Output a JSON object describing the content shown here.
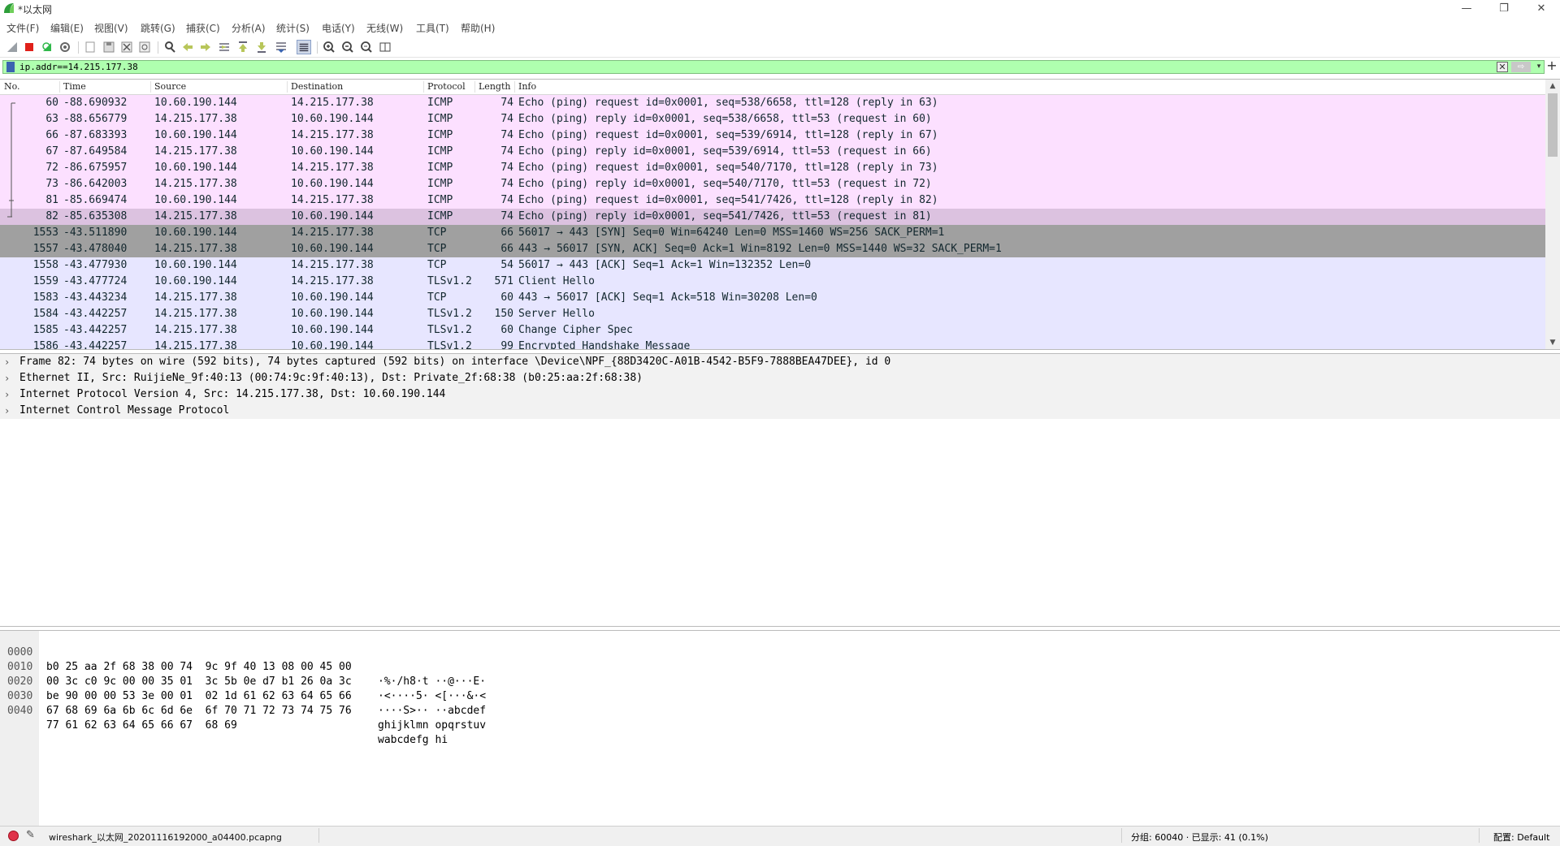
{
  "window": {
    "title": "*以太网",
    "minimize": "—",
    "restore": "❐",
    "close": "✕"
  },
  "menu": [
    "文件(F)",
    "编辑(E)",
    "视图(V)",
    "跳转(G)",
    "捕获(C)",
    "分析(A)",
    "统计(S)",
    "电话(Y)",
    "无线(W)",
    "工具(T)",
    "帮助(H)"
  ],
  "filter": {
    "value": "ip.addr==14.215.177.38",
    "clear": "✕",
    "apply": "⇨",
    "dropdown": "▾",
    "add": "+"
  },
  "packet_columns": {
    "no": "No.",
    "time": "Time",
    "source": "Source",
    "destination": "Destination",
    "protocol": "Protocol",
    "length": "Length",
    "info": "Info"
  },
  "packets": [
    {
      "no": "60",
      "time": "-88.690932",
      "src": "10.60.190.144",
      "dst": "14.215.177.38",
      "proto": "ICMP",
      "len": "74",
      "info": "Echo (ping) request  id=0x0001, seq=538/6658, ttl=128 (reply in 63)",
      "bg": "#fce0ff",
      "fg": "#12272e"
    },
    {
      "no": "63",
      "time": "-88.656779",
      "src": "14.215.177.38",
      "dst": "10.60.190.144",
      "proto": "ICMP",
      "len": "74",
      "info": "Echo (ping) reply    id=0x0001, seq=538/6658, ttl=53 (request in 60)",
      "bg": "#fce0ff",
      "fg": "#12272e"
    },
    {
      "no": "66",
      "time": "-87.683393",
      "src": "10.60.190.144",
      "dst": "14.215.177.38",
      "proto": "ICMP",
      "len": "74",
      "info": "Echo (ping) request  id=0x0001, seq=539/6914, ttl=128 (reply in 67)",
      "bg": "#fce0ff",
      "fg": "#12272e"
    },
    {
      "no": "67",
      "time": "-87.649584",
      "src": "14.215.177.38",
      "dst": "10.60.190.144",
      "proto": "ICMP",
      "len": "74",
      "info": "Echo (ping) reply    id=0x0001, seq=539/6914, ttl=53 (request in 66)",
      "bg": "#fce0ff",
      "fg": "#12272e"
    },
    {
      "no": "72",
      "time": "-86.675957",
      "src": "10.60.190.144",
      "dst": "14.215.177.38",
      "proto": "ICMP",
      "len": "74",
      "info": "Echo (ping) request  id=0x0001, seq=540/7170, ttl=128 (reply in 73)",
      "bg": "#fce0ff",
      "fg": "#12272e"
    },
    {
      "no": "73",
      "time": "-86.642003",
      "src": "14.215.177.38",
      "dst": "10.60.190.144",
      "proto": "ICMP",
      "len": "74",
      "info": "Echo (ping) reply    id=0x0001, seq=540/7170, ttl=53 (request in 72)",
      "bg": "#fce0ff",
      "fg": "#12272e"
    },
    {
      "no": "81",
      "time": "-85.669474",
      "src": "10.60.190.144",
      "dst": "14.215.177.38",
      "proto": "ICMP",
      "len": "74",
      "info": "Echo (ping) request  id=0x0001, seq=541/7426, ttl=128 (reply in 82)",
      "bg": "#fce0ff",
      "fg": "#12272e"
    },
    {
      "no": "82",
      "time": "-85.635308",
      "src": "14.215.177.38",
      "dst": "10.60.190.144",
      "proto": "ICMP",
      "len": "74",
      "info": "Echo (ping) reply    id=0x0001, seq=541/7426, ttl=53 (request in 81)",
      "bg": "#dcc2e0",
      "fg": "#12272e"
    },
    {
      "no": "1553",
      "time": "-43.511890",
      "src": "10.60.190.144",
      "dst": "14.215.177.38",
      "proto": "TCP",
      "len": "66",
      "info": "56017 → 443 [SYN] Seq=0 Win=64240 Len=0 MSS=1460 WS=256 SACK_PERM=1",
      "bg": "#a0a0a0",
      "fg": "#12272e"
    },
    {
      "no": "1557",
      "time": "-43.478040",
      "src": "14.215.177.38",
      "dst": "10.60.190.144",
      "proto": "TCP",
      "len": "66",
      "info": "443 → 56017 [SYN, ACK] Seq=0 Ack=1 Win=8192 Len=0 MSS=1440 WS=32 SACK_PERM=1",
      "bg": "#a0a0a0",
      "fg": "#12272e"
    },
    {
      "no": "1558",
      "time": "-43.477930",
      "src": "10.60.190.144",
      "dst": "14.215.177.38",
      "proto": "TCP",
      "len": "54",
      "info": "56017 → 443 [ACK] Seq=1 Ack=1 Win=132352 Len=0",
      "bg": "#e7e6ff",
      "fg": "#12272e"
    },
    {
      "no": "1559",
      "time": "-43.477724",
      "src": "10.60.190.144",
      "dst": "14.215.177.38",
      "proto": "TLSv1.2",
      "len": "571",
      "info": "Client Hello",
      "bg": "#e7e6ff",
      "fg": "#12272e"
    },
    {
      "no": "1583",
      "time": "-43.443234",
      "src": "14.215.177.38",
      "dst": "10.60.190.144",
      "proto": "TCP",
      "len": "60",
      "info": "443 → 56017 [ACK] Seq=1 Ack=518 Win=30208 Len=0",
      "bg": "#e7e6ff",
      "fg": "#12272e"
    },
    {
      "no": "1584",
      "time": "-43.442257",
      "src": "14.215.177.38",
      "dst": "10.60.190.144",
      "proto": "TLSv1.2",
      "len": "150",
      "info": "Server Hello",
      "bg": "#e7e6ff",
      "fg": "#12272e"
    },
    {
      "no": "1585",
      "time": "-43.442257",
      "src": "14.215.177.38",
      "dst": "10.60.190.144",
      "proto": "TLSv1.2",
      "len": "60",
      "info": "Change Cipher Spec",
      "bg": "#e7e6ff",
      "fg": "#12272e"
    },
    {
      "no": "1586",
      "time": "-43.442257",
      "src": "14.215.177.38",
      "dst": "10.60.190.144",
      "proto": "TLSv1.2",
      "len": "99",
      "info": "Encrypted Handshake Message",
      "bg": "#e7e6ff",
      "fg": "#12272e"
    }
  ],
  "details": [
    "Frame 82: 74 bytes on wire (592 bits), 74 bytes captured (592 bits) on interface \\Device\\NPF_{88D3420C-A01B-4542-B5F9-7888BEA47DEE}, id 0",
    "Ethernet II, Src: RuijieNe_9f:40:13 (00:74:9c:9f:40:13), Dst: Private_2f:68:38 (b0:25:aa:2f:68:38)",
    "Internet Protocol Version 4, Src: 14.215.177.38, Dst: 10.60.190.144",
    "Internet Control Message Protocol"
  ],
  "details_expander": "›",
  "bytes": [
    {
      "offset": "0000",
      "hex": "b0 25 aa 2f 68 38 00 74  9c 9f 40 13 08 00 45 00",
      "ascii": "·%·/h8·t ··@···E·"
    },
    {
      "offset": "0010",
      "hex": "00 3c c0 9c 00 00 35 01  3c 5b 0e d7 b1 26 0a 3c",
      "ascii": "·<····5· <[···&·<"
    },
    {
      "offset": "0020",
      "hex": "be 90 00 00 53 3e 00 01  02 1d 61 62 63 64 65 66",
      "ascii": "····S>·· ··abcdef"
    },
    {
      "offset": "0030",
      "hex": "67 68 69 6a 6b 6c 6d 6e  6f 70 71 72 73 74 75 76",
      "ascii": "ghijklmn opqrstuv"
    },
    {
      "offset": "0040",
      "hex": "77 61 62 63 64 65 66 67  68 69",
      "ascii": "wabcdefg hi"
    }
  ],
  "status": {
    "file": "wireshark_以太网_20201116192000_a04400.pcapng",
    "packets": "分组: 60040 · 已显示: 41 (0.1%)",
    "profile": "配置: Default",
    "comment_icon": "✎"
  },
  "colors": {
    "filter_valid": "#afffaf",
    "icmp_row": "#fce0ff",
    "selected_row": "#dcc2e0",
    "tcp_syn_row": "#a0a0a0",
    "tcp_row": "#e7e6ff"
  }
}
